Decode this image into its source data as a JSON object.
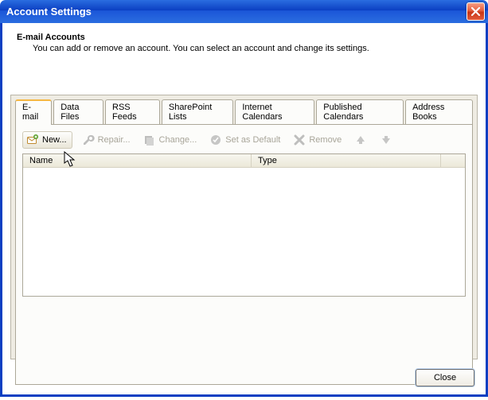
{
  "window": {
    "title": "Account Settings"
  },
  "header": {
    "title": "E-mail Accounts",
    "desc": "You can add or remove an account. You can select an account and change its settings."
  },
  "tabs": [
    {
      "label": "E-mail",
      "active": true
    },
    {
      "label": "Data Files"
    },
    {
      "label": "RSS Feeds"
    },
    {
      "label": "SharePoint Lists"
    },
    {
      "label": "Internet Calendars"
    },
    {
      "label": "Published Calendars"
    },
    {
      "label": "Address Books"
    }
  ],
  "toolbar": {
    "new": {
      "label": "New...",
      "enabled": true
    },
    "repair": {
      "label": "Repair...",
      "enabled": false
    },
    "change": {
      "label": "Change...",
      "enabled": false
    },
    "default": {
      "label": "Set as Default",
      "enabled": false
    },
    "remove": {
      "label": "Remove",
      "enabled": false
    }
  },
  "columns": {
    "name": "Name",
    "type": "Type"
  },
  "rows": [],
  "buttons": {
    "close": "Close"
  }
}
